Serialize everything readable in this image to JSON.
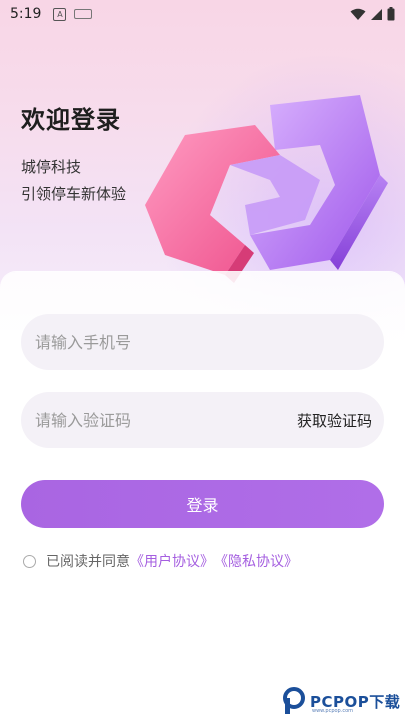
{
  "status_bar": {
    "time": "5:19",
    "icons": [
      "a-notification-icon",
      "keyboard-icon",
      "wifi-icon",
      "signal-icon",
      "battery-icon"
    ]
  },
  "welcome": {
    "title": "欢迎登录",
    "company": "城停科技",
    "slogan": "引领停车新体验"
  },
  "form": {
    "phone_placeholder": "请输入手机号",
    "code_placeholder": "请输入验证码",
    "get_code_label": "获取验证码",
    "login_label": "登录"
  },
  "agreement": {
    "prefix": "已阅读并同意",
    "user_agreement": "《用户协议》",
    "privacy_agreement": "《隐私协议》",
    "checked": false
  },
  "watermark": {
    "brand": "PCPOP下载",
    "sub": "www.pcpop.com"
  },
  "colors": {
    "accent": "#b06ee8",
    "link": "#a55fe0",
    "pink": "#f1649a",
    "field_bg": "#f4f1f7"
  }
}
